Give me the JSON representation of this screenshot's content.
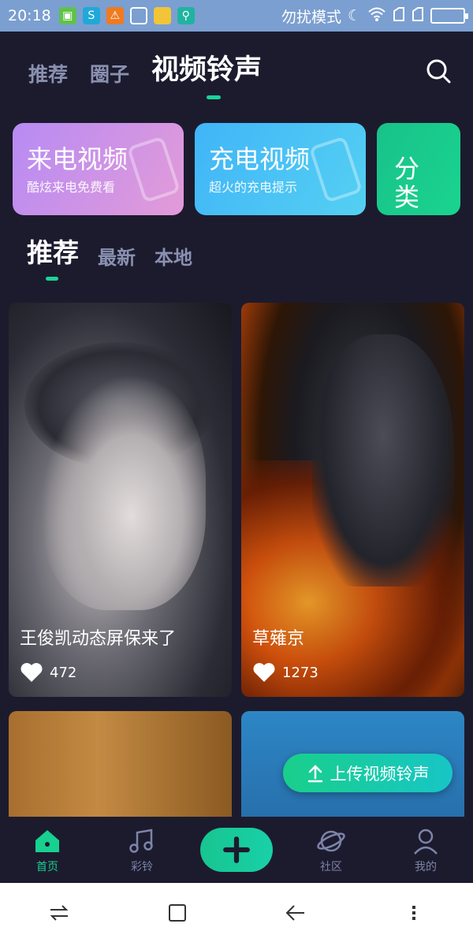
{
  "status_bar": {
    "time": "20:18",
    "mode_text": "勿扰模式"
  },
  "top_tabs": [
    {
      "label": "推荐",
      "active": false
    },
    {
      "label": "圈子",
      "active": false
    },
    {
      "label": "视频铃声",
      "active": true
    }
  ],
  "feature_cards": [
    {
      "title": "来电视频",
      "subtitle": "酷炫来电免费看"
    },
    {
      "title": "充电视频",
      "subtitle": "超火的充电提示"
    },
    {
      "title": "分类",
      "subtitle": ""
    }
  ],
  "sub_tabs": [
    {
      "label": "推荐",
      "active": true
    },
    {
      "label": "最新",
      "active": false
    },
    {
      "label": "本地",
      "active": false
    }
  ],
  "videos": [
    {
      "title": "王俊凯动态屏保来了",
      "likes": "472"
    },
    {
      "title": "草薙京",
      "likes": "1273"
    }
  ],
  "upload_button": {
    "label": "上传视频铃声"
  },
  "bottom_nav": [
    {
      "label": "首页",
      "icon": "home-icon",
      "active": true
    },
    {
      "label": "彩铃",
      "icon": "music-icon",
      "active": false
    },
    {
      "label": "社区",
      "icon": "planet-icon",
      "active": false
    },
    {
      "label": "我的",
      "icon": "user-icon",
      "active": false
    }
  ],
  "colors": {
    "background": "#1c1b2e",
    "accent": "#19d497",
    "status_bar": "#7b9fd0"
  }
}
